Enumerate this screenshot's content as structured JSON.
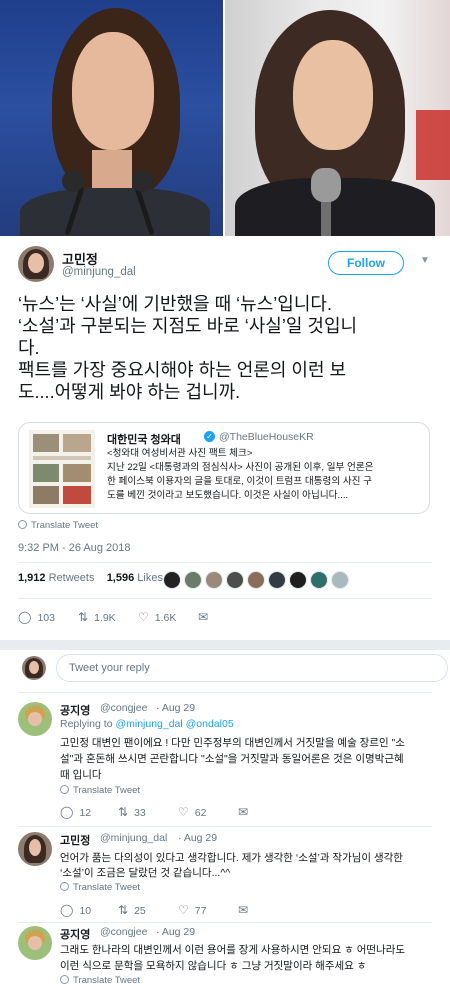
{
  "tweet": {
    "author_name": "고민정",
    "author_handle": "@minjung_dal",
    "follow_label": "Follow",
    "text_lines": [
      "‘뉴스’는 ‘사실’에 기반했을 때 ‘뉴스’입니다.",
      "‘소설’과 구분되는 지점도 바로 ‘사실’일 것입니",
      "다.",
      "팩트를 가장 중요시해야 하는 언론의 이런 보",
      "도....어떻게 봐야 하는 겁니까."
    ],
    "quote": {
      "name": "대한민국 청와대",
      "handle": "@TheBlueHouseKR",
      "lines": [
        "<청와대 여성비서관 사진 팩트 체크>",
        "지난 22일 <대통령과의 점심식사> 사진이 공개된 이후, 일부 언론은",
        "한 페이스북 이용자의 글을 토대로, 이것이 트럼프 대통령의 사진 구",
        "도를 베낀 것이라고 보도했습니다. 이것은 사실이 아닙니다...."
      ]
    },
    "translate_label": "Translate Tweet",
    "timestamp": "9:32 PM - 26 Aug 2018",
    "retweets_count": "1,912",
    "retweets_label": "Retweets",
    "likes_count": "1,596",
    "likes_label": "Likes",
    "actions": {
      "replies": "103",
      "retweets": "1.9K",
      "likes": "1.6K"
    }
  },
  "reply_box": {
    "placeholder": "Tweet your reply"
  },
  "replies": [
    {
      "name": "공지영",
      "handle": "@congjee",
      "date": "· Aug 29",
      "replying_prefix": "Replying to",
      "replying_to": "@minjung_dal @ondal05",
      "lines": [
        "고민정 대변인 팬이에요 ! 다만 민주정부의  대변인께서 거짓말을 예술 장르인 \"소",
        "설\"과 혼돈해 쓰시면 곤란합니다 \"소설\"을 거짓말과 동일어론은 것은 이명박근혜",
        "때 입니다"
      ],
      "translate_label": "Translate Tweet",
      "replies": "12",
      "retweets": "33",
      "likes": "62"
    },
    {
      "name": "고민정",
      "handle": "@minjung_dal",
      "date": "· Aug 29",
      "lines": [
        "언어가 품는 다의성이 있다고 생각합니다. 제가 생각한 ‘소설’과 작가님이 생각한",
        "‘소설’이 조금은 달랐던 것 같습니다...^^"
      ],
      "translate_label": "Translate Tweet",
      "replies": "10",
      "retweets": "25",
      "likes": "77"
    },
    {
      "name": "공지영",
      "handle": "@congjee",
      "date": "· Aug 29",
      "lines": [
        "그래도 한나라의 대변인께서 이런 용어를 장게 사용하시면 안되요 ㅎ 어떤나라도",
        "이런 식으로 문학을 모욕하지 않습니다 ㅎ 그냥 거짓말이라 해주세요 ㅎ"
      ],
      "translate_label": "Translate Tweet"
    }
  ],
  "colors": {
    "accent": "#1da1f2",
    "muted": "#657786",
    "divider": "#e6ecf0"
  }
}
